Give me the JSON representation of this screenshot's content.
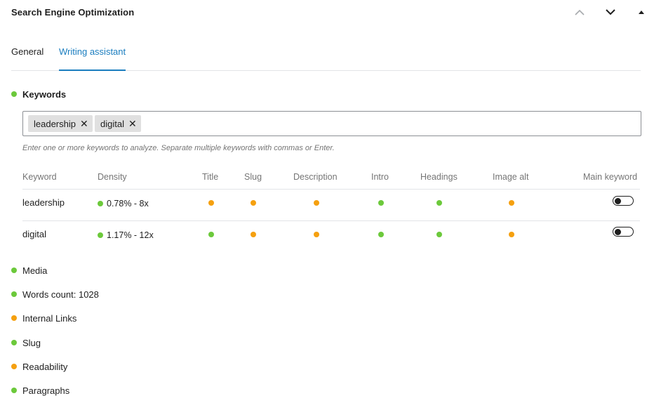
{
  "panel": {
    "title": "Search Engine Optimization"
  },
  "tabs": [
    {
      "label": "General",
      "active": false
    },
    {
      "label": "Writing assistant",
      "active": true
    }
  ],
  "keywords": {
    "heading": "Keywords",
    "status": "good",
    "tags": [
      "leadership",
      "digital"
    ],
    "remove_glyph": "✕",
    "hint": "Enter one or more keywords to analyze. Separate multiple keywords with commas or Enter."
  },
  "table": {
    "headers": [
      "Keyword",
      "Density",
      "Title",
      "Slug",
      "Description",
      "Intro",
      "Headings",
      "Image alt",
      "Main keyword"
    ],
    "rows": [
      {
        "keyword": "leadership",
        "density": "0.78% - 8x",
        "density_status": "good",
        "checks": {
          "title": "warning",
          "slug": "warning",
          "description": "warning",
          "intro": "good",
          "headings": "good",
          "image_alt": "warning"
        },
        "main_keyword": false
      },
      {
        "keyword": "digital",
        "density": "1.17% - 12x",
        "density_status": "good",
        "checks": {
          "title": "good",
          "slug": "warning",
          "description": "warning",
          "intro": "good",
          "headings": "good",
          "image_alt": "warning"
        },
        "main_keyword": false
      }
    ]
  },
  "checks": [
    {
      "label": "Media",
      "status": "good"
    },
    {
      "label": "Words count: 1028",
      "status": "good"
    },
    {
      "label": "Internal Links",
      "status": "warning"
    },
    {
      "label": "Slug",
      "status": "good"
    },
    {
      "label": "Readability",
      "status": "warning"
    },
    {
      "label": "Paragraphs",
      "status": "good"
    }
  ],
  "colors": {
    "good": "#6cc93b",
    "warning": "#f5a00f",
    "accent": "#1a7dbf"
  },
  "icons": {
    "move_up": "chevron-up-icon",
    "move_down": "chevron-down-icon",
    "toggle_panel": "caret-up-icon"
  }
}
